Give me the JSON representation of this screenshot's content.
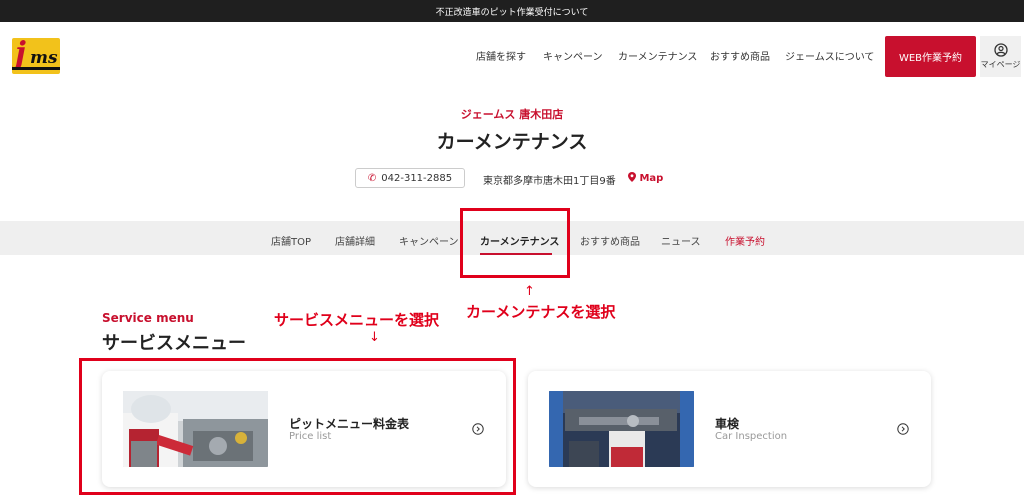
{
  "notice_bar": {
    "text": "不正改造車のピット作業受付について"
  },
  "header": {
    "logo_text": "jms",
    "nav": [
      "店舗を探す",
      "キャンペーン",
      "カーメンテナンス",
      "おすすめ商品",
      "ジェームスについて"
    ],
    "web_reserve_label": "WEB作業予約",
    "mypage_label": "マイページ"
  },
  "store": {
    "name": "ジェームス 唐木田店",
    "page_title": "カーメンテナンス",
    "phone": "042-311-2885",
    "address": "東京都多摩市唐木田1丁目9番",
    "map_label": "Map"
  },
  "tabs": [
    {
      "label": "店舗TOP"
    },
    {
      "label": "店舗詳細"
    },
    {
      "label": "キャンペーン"
    },
    {
      "label": "カーメンテナンス"
    },
    {
      "label": "おすすめ商品"
    },
    {
      "label": "ニュース"
    },
    {
      "label": "作業予約"
    }
  ],
  "active_tab": "カーメンテナンス",
  "annotations": {
    "tab_arrow": "↑",
    "tab_note": "カーメンテナスを選択",
    "service_note": "サービスメニューを選択",
    "service_arrow": "↓"
  },
  "service": {
    "heading_en": "Service menu",
    "heading_jp": "サービスメニュー",
    "cards": [
      {
        "title": "ピットメニュー料金表",
        "subtitle": "Price list"
      },
      {
        "title": "車検",
        "subtitle": "Car Inspection"
      }
    ]
  },
  "colors": {
    "accent": "#c8102e",
    "highlight": "#e0001b",
    "topbar": "#1f1f1f",
    "tabbar": "#efefef"
  },
  "icons": [
    "phone-icon",
    "map-pin-icon",
    "user-icon",
    "arrow-circle-right-icon"
  ]
}
